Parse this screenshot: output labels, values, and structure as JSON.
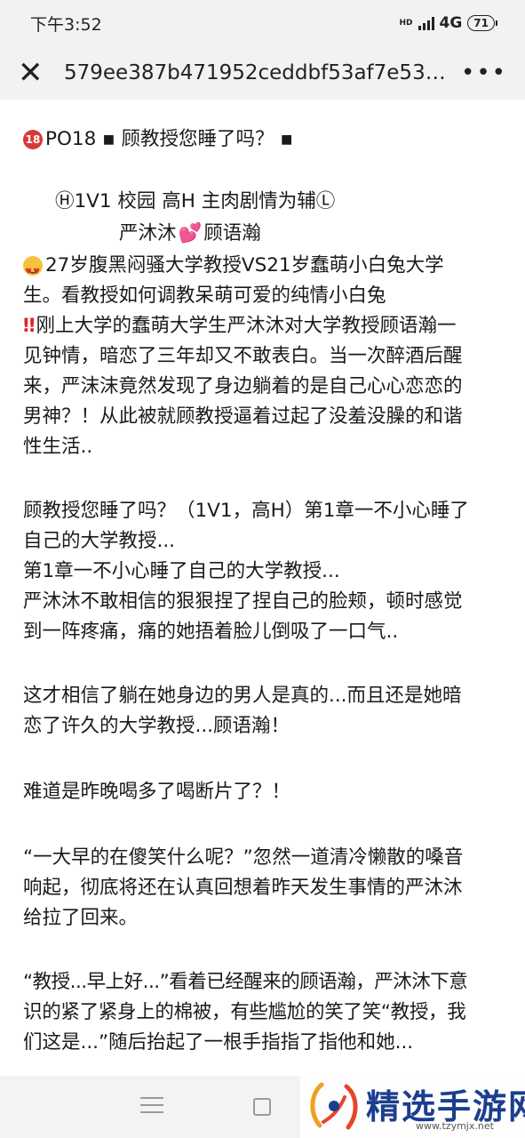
{
  "status_bar": {
    "time": "下午3:52",
    "hd_label": "HD",
    "network": "4G",
    "battery": "71"
  },
  "header": {
    "close_label": "✕",
    "title": "579ee387b471952ceddbf53af7e53dbb...",
    "more_label": "•••"
  },
  "article": {
    "lines": [
      "PO18 ▪ 顾教授您睡了吗？ ▪",
      "Ⓗ1V1 校园 高H 主肉剧情为辅Ⓛ",
      "严沐沐",
      "顾语瀚",
      "27岁腹黑闷骚大学教授VS21岁蠢萌小白兔大学",
      "生。看教授如何调教呆萌可爱的纯情小白兔",
      "刚上大学的蠢萌大学生严沐沐对大学教授顾语瀚一",
      "见钟情，暗恋了三年却又不敢表白。当一次醉酒后醒",
      "来，严沫沫竟然发现了身边躺着的是自己心心恋恋的",
      "男神？！从此被就顾教授逼着过起了没羞没臊的和谐",
      "性生活..",
      "顾教授您睡了吗？（1V1，高H）第1章一不小心睡了",
      "自己的大学教授...",
      "第1章一不小心睡了自己的大学教授...",
      "严沐沐不敢相信的狠狠捏了捏自己的脸颊，顿时感觉",
      "到一阵疼痛，痛的她捂着脸儿倒吸了一口气..",
      "这才相信了躺在她身边的男人是真的...而且还是她暗",
      "恋了许久的大学教授...顾语瀚！",
      "难道是昨晚喝多了喝断片了？！",
      "“一大早的在傻笑什么呢？”忽然一道清冷懒散的嗓音",
      "响起，彻底将还在认真回想着昨天发生事情的严沐沐",
      "给拉了回来。",
      "“教授...早上好...”看着已经醒来的顾语瀚，严沐沐下意",
      "识的紧了紧身上的棉被，有些尴尬的笑了笑“教授，我",
      "们这是...”随后抬起了一根手指指了指他和她..."
    ]
  },
  "icons": {
    "age_badge": "18",
    "heart": "💕",
    "bang": "‼"
  },
  "watermark": {
    "text": "精选手游网",
    "url": "www.tzymjx.net"
  }
}
